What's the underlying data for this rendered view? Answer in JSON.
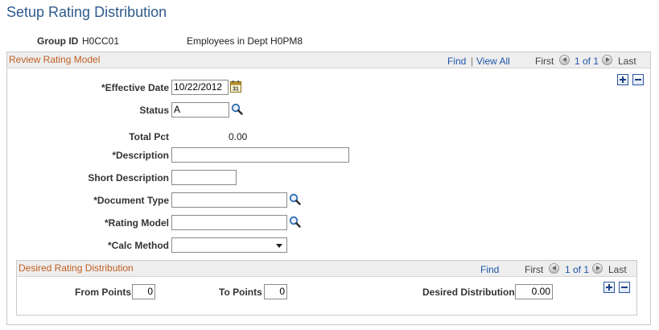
{
  "page": {
    "title": "Setup Rating Distribution"
  },
  "group": {
    "id_label": "Group ID",
    "id_value": "H0CC01",
    "description": "Employees in Dept H0PM8"
  },
  "review_panel": {
    "title": "Review Rating Model",
    "find": "Find",
    "separator": "|",
    "view_all": "View All",
    "first": "First",
    "range": "1 of 1",
    "last": "Last"
  },
  "fields": {
    "effective_date_label": "*Effective Date",
    "effective_date_value": "10/22/2012",
    "status_label": "Status",
    "status_value": "A",
    "total_pct_label": "Total Pct",
    "total_pct_value": "0.00",
    "description_label": "*Description",
    "description_value": "",
    "short_description_label": "Short Description",
    "short_description_value": "",
    "document_type_label": "*Document Type",
    "document_type_value": "",
    "rating_model_label": "*Rating Model",
    "rating_model_value": "",
    "calc_method_label": "*Calc Method",
    "calc_method_value": ""
  },
  "distribution_panel": {
    "title": "Desired Rating Distribution",
    "find": "Find",
    "first": "First",
    "range": "1 of 1",
    "last": "Last",
    "from_points_label": "From Points",
    "from_points_value": "0",
    "to_points_label": "To Points",
    "to_points_value": "0",
    "desired_distribution_label": "Desired Distribution",
    "desired_distribution_value": "0.00"
  },
  "icons": {
    "calendar": "calendar-icon",
    "search": "magnifier-icon",
    "add": "plus-icon",
    "remove": "minus-icon",
    "prev": "previous-arrow-icon",
    "next": "next-arrow-icon"
  },
  "colors": {
    "title": "#2e5a8c",
    "panel_title": "#c15f24",
    "link": "#1e56a8",
    "button_border": "#2b55a0"
  }
}
